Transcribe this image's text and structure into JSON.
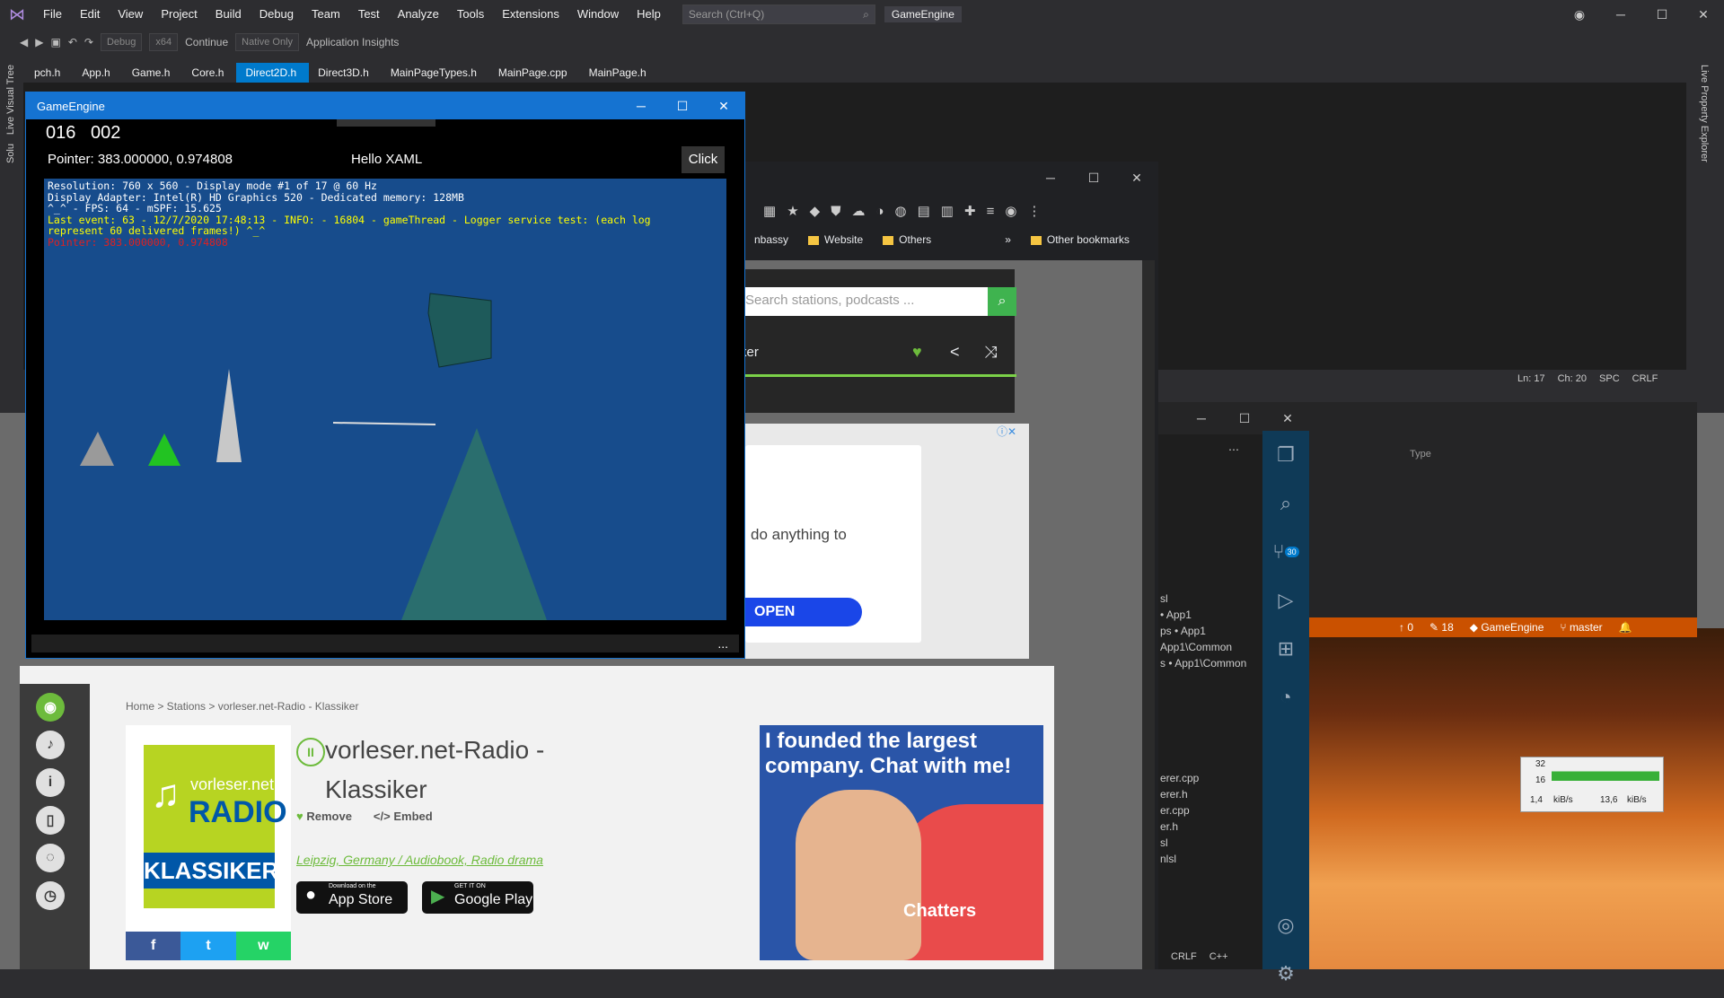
{
  "vs": {
    "menu": [
      "File",
      "Edit",
      "View",
      "Project",
      "Build",
      "Debug",
      "Team",
      "Test",
      "Analyze",
      "Tools",
      "Extensions",
      "Window",
      "Help"
    ],
    "search_placeholder": "Search (Ctrl+Q)",
    "solution_name": "GameEngine",
    "toolbar": {
      "config": "Debug",
      "platform": "x64",
      "continue": "Continue",
      "native": "Native Only",
      "insights": "Application Insights"
    },
    "tabs": [
      "pch.h",
      "App.h",
      "Game.h",
      "Core.h",
      "Direct2D.h",
      "Direct3D.h",
      "MainPageTypes.h",
      "MainPage.cpp",
      "MainPage.h"
    ],
    "active_tab": "Direct2D.h",
    "left_panels": [
      "Live Visual Tree",
      "Solu"
    ],
    "right_panel": "Live Property Explorer",
    "status": {
      "ln": "Ln: 17",
      "ch": "Ch: 20",
      "spc": "SPC",
      "crlf": "CRLF"
    },
    "panel_col": "Type",
    "git": {
      "up": "0",
      "changes": "18",
      "repo": "GameEngine",
      "branch": "master"
    }
  },
  "vscode": {
    "files": [
      "sl",
      "• App1",
      "ps • App1",
      "App1\\Common",
      "s • App1\\Common",
      "erer.cpp",
      "erer.h",
      "er.cpp",
      "er.h",
      "sl",
      "nlsl"
    ],
    "status": [
      "CRLF",
      "C++"
    ],
    "badge": "30"
  },
  "netmeter": {
    "hi": "32",
    "lo": "16",
    "unit": "kiB/s",
    "down": "1,4",
    "up": "13,6"
  },
  "browser": {
    "bookmarks": [
      "nbassy",
      "Website",
      "Others"
    ],
    "other_bookmarks": "Other bookmarks",
    "more": "»"
  },
  "radio": {
    "search_placeholder": "Search stations, podcasts ...",
    "player_text": "ker",
    "ad_text": "do anything to",
    "open_btn": "OPEN",
    "breadcrumb": "Home > Stations > vorleser.net-Radio - Klassiker",
    "title": "vorleser.net-Radio - Klassiker",
    "remove": "Remove",
    "embed": "Embed",
    "tags": "Leipzig, Germany / Audiobook, Radio drama",
    "logo_top": "vorleser.net",
    "logo_radio": "RADIO",
    "logo_klassiker": "KLASSIKER",
    "appstore": "App Store",
    "appstore_small": "Download on the",
    "googleplay": "Google Play",
    "googleplay_small": "GET IT ON",
    "ad_headline": "I founded the largest company. Chat with me!",
    "ad_brand": "Chatters",
    "share": [
      "f",
      "t",
      "w"
    ]
  },
  "game": {
    "title": "GameEngine",
    "counter_a": "016",
    "counter_b": "002",
    "pointer": "Pointer: 383.000000, 0.974808",
    "hello": "Hello XAML",
    "click": "Click",
    "overlay": [
      "Resolution: 760 x 560 - Display mode #1 of 17 @ 60 Hz",
      "Display Adapter: Intel(R) HD Graphics 520 - Dedicated memory: 128MB",
      "^_^ - FPS: 64 - mSPF: 15.625"
    ],
    "event": "Last event: 63 - 12/7/2020 17:48:13 - INFO: - 16804 - gameThread - Logger service test: (each log\nrepresent 60 delivered frames!) ^_^",
    "pointer_red": "Pointer: 383.000000, 0.974808",
    "footer": "..."
  },
  "colors": {
    "accent": "#007acc",
    "green": "#6dbb3c",
    "git": "#ca5100",
    "game_bg": "#174c8c"
  }
}
